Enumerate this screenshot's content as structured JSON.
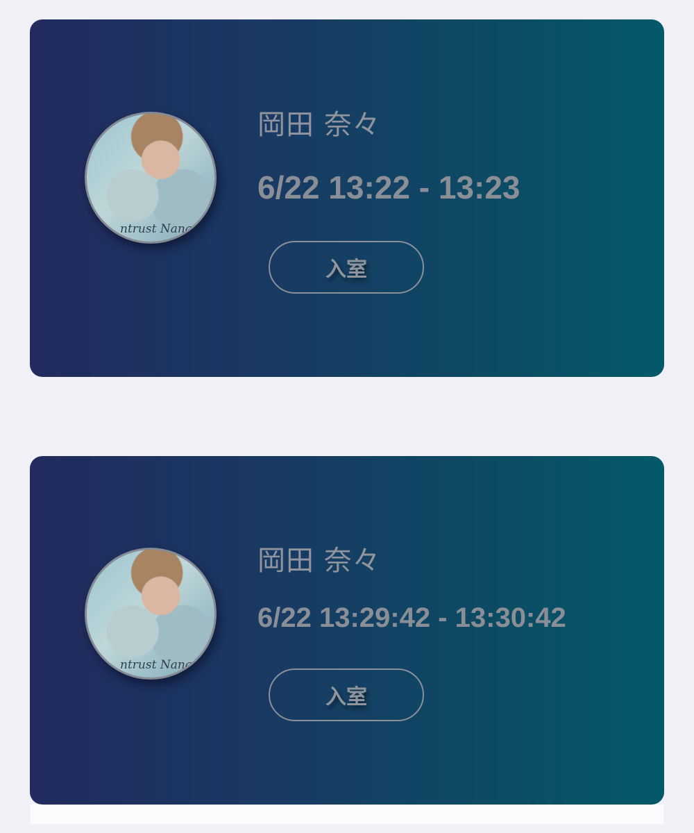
{
  "sessions": [
    {
      "name": "岡田 奈々",
      "time": "6/22 13:22 - 13:23",
      "button_label": "入室",
      "avatar_caption": "ntrust Nana O"
    },
    {
      "name": "岡田 奈々",
      "time": "6/22 13:29:42 - 13:30:42",
      "button_label": "入室",
      "avatar_caption": "ntrust Nana O"
    }
  ]
}
